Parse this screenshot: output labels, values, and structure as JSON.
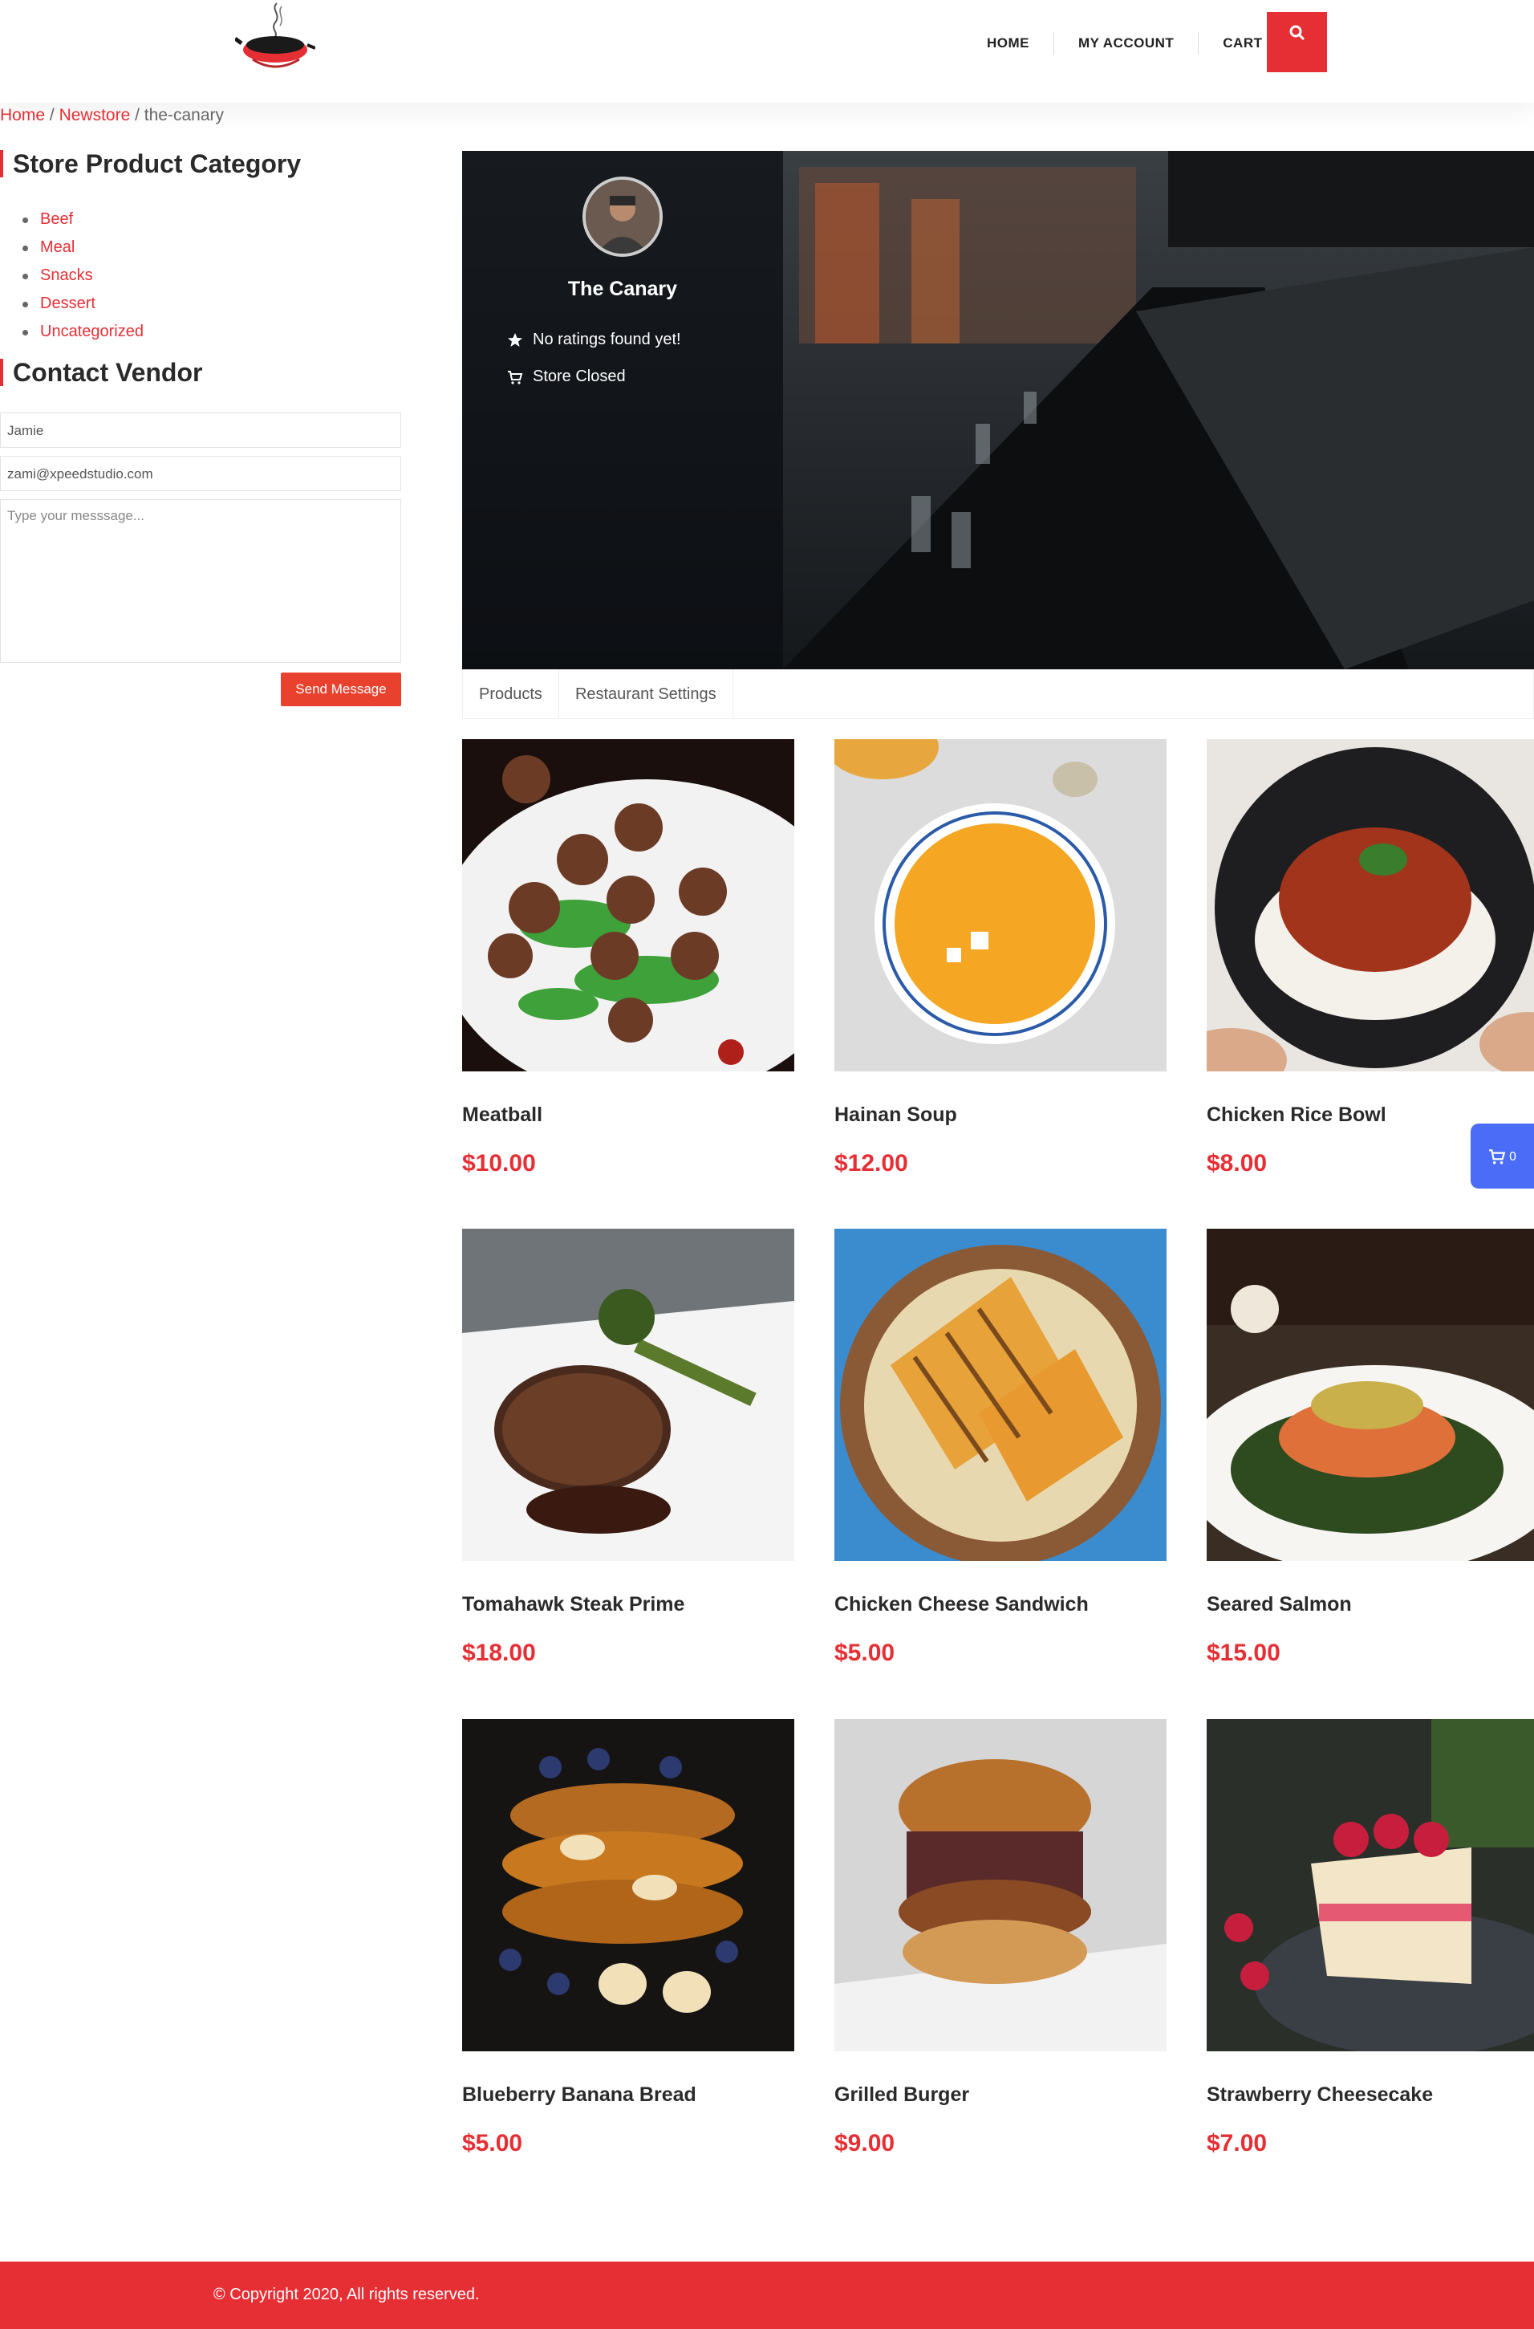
{
  "header": {
    "nav": [
      {
        "label": "HOME"
      },
      {
        "label": "MY ACCOUNT"
      },
      {
        "label": "CART"
      }
    ],
    "icons": {
      "logo": "wok-pan-logo",
      "search": "search-icon"
    },
    "accent_color": "#e52f35"
  },
  "breadcrumb": {
    "home": "Home",
    "sep": "/",
    "store": "Newstore",
    "current": "the-canary"
  },
  "sidebar": {
    "category_title": "Store Product Category",
    "categories": [
      "Beef",
      "Meal",
      "Snacks",
      "Dessert",
      "Uncategorized"
    ],
    "contact_title": "Contact Vendor",
    "name_value": "Jamie",
    "email_value": "zami@xpeedstudio.com",
    "message_placeholder": "Type your messsage...",
    "send_label": "Send Message"
  },
  "store": {
    "name": "The Canary",
    "rating_text": "No ratings found yet!",
    "status_text": "Store Closed"
  },
  "tabs": [
    "Products",
    "Restaurant Settings"
  ],
  "products": [
    {
      "name": "Meatball",
      "price": "$10.00",
      "image": "meatball-plate"
    },
    {
      "name": "Hainan Soup",
      "price": "$12.00",
      "image": "pumpkin-soup-bowl"
    },
    {
      "name": "Chicken Rice Bowl",
      "price": "$8.00",
      "image": "chicken-rice-bowl"
    },
    {
      "name": "Tomahawk Steak Prime",
      "price": "$18.00",
      "image": "steak-plate"
    },
    {
      "name": "Chicken Cheese Sandwich",
      "price": "$5.00",
      "image": "grilled-sandwich"
    },
    {
      "name": "Seared Salmon",
      "price": "$15.00",
      "image": "salmon-plate"
    },
    {
      "name": "Blueberry Banana Bread",
      "price": "$5.00",
      "image": "french-toast-stack"
    },
    {
      "name": "Grilled Burger",
      "price": "$9.00",
      "image": "burger"
    },
    {
      "name": "Strawberry Cheesecake",
      "price": "$7.00",
      "image": "cheesecake-slice"
    }
  ],
  "cart": {
    "count": "0"
  },
  "footer": {
    "text": "© Copyright 2020, All rights reserved."
  }
}
